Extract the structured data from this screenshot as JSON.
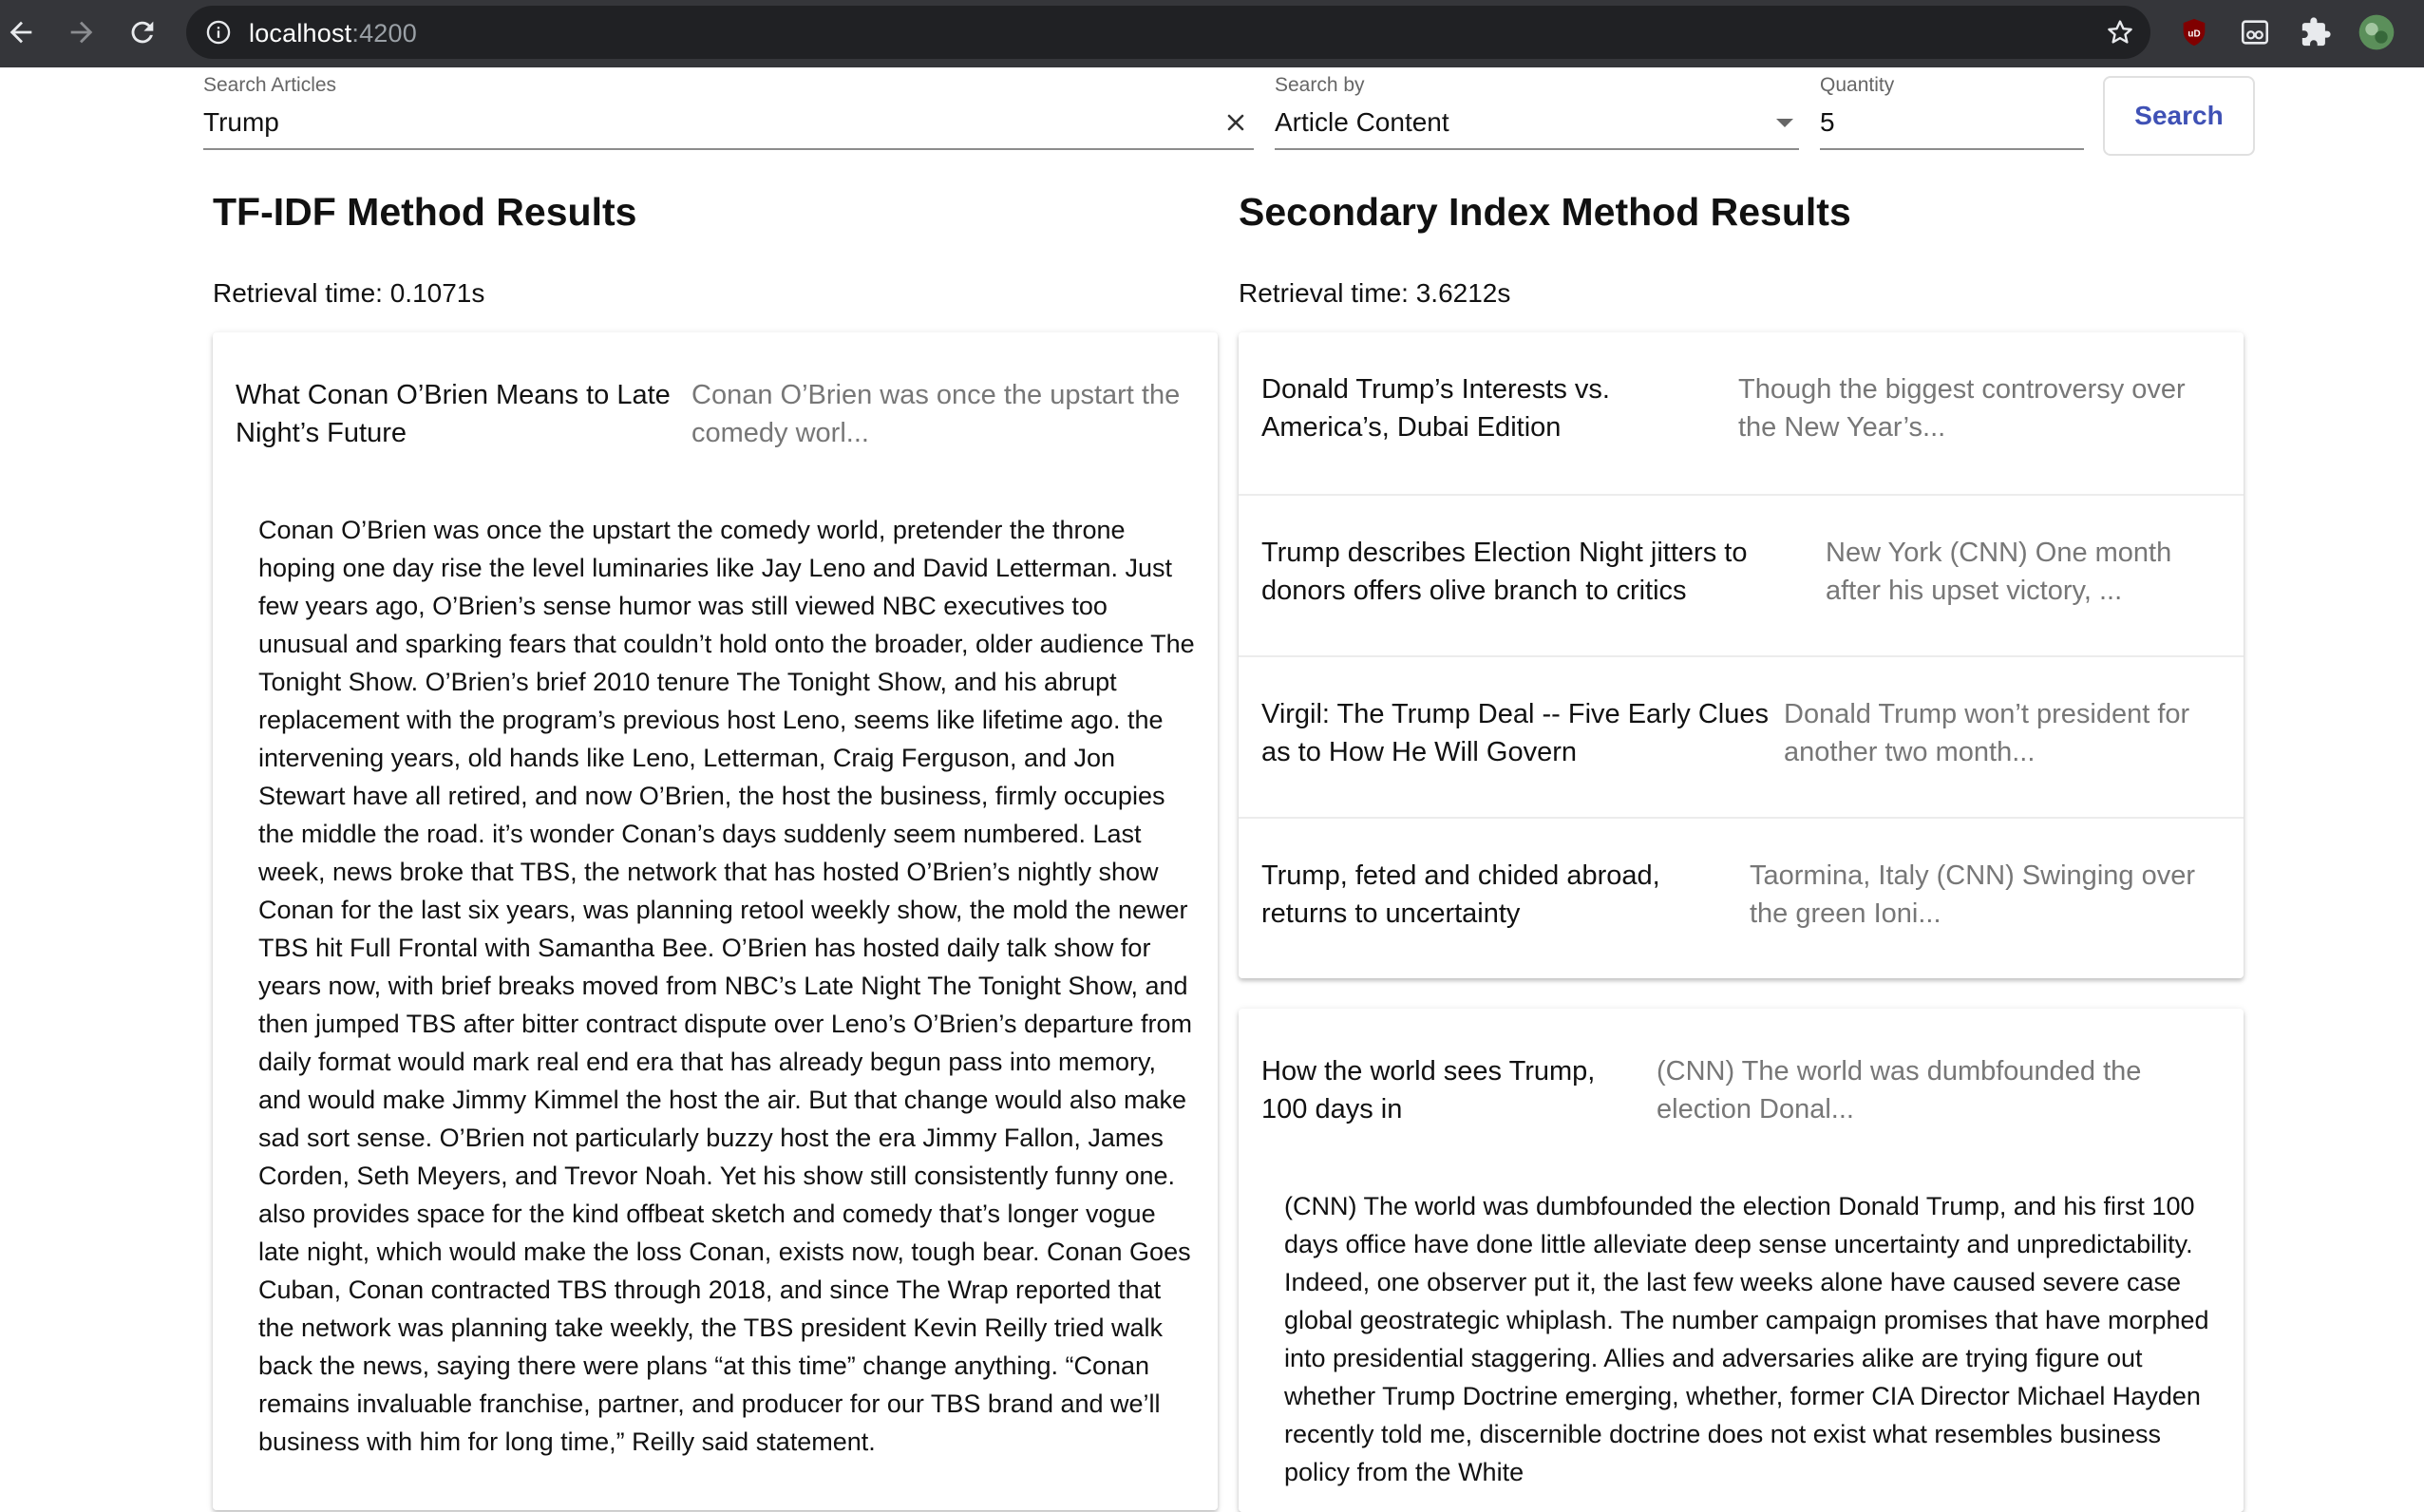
{
  "browser": {
    "url_host": "localhost",
    "url_port": ":4200"
  },
  "search_form": {
    "query_label": "Search Articles",
    "query_value": "Trump",
    "search_by_label": "Search by",
    "search_by_value": "Article Content",
    "quantity_label": "Quantity",
    "quantity_value": "5",
    "search_button": "Search"
  },
  "tfidf": {
    "title": "TF-IDF Method Results",
    "retrieval": "Retrieval time: 0.1071s",
    "items": [
      {
        "title": "What Conan O’Brien Means to Late Night’s Future",
        "snippet": "Conan O’Brien was once the upstart the comedy worl...",
        "body": "Conan O’Brien was once the upstart the comedy world, pretender the throne hoping one day rise the level luminaries like Jay Leno and David Letterman. Just few years ago, O’Brien’s sense humor was still viewed NBC executives too unusual and sparking fears that couldn’t hold onto the broader, older audience The Tonight Show. O’Brien’s brief 2010 tenure The Tonight Show, and his abrupt replacement with the program’s previous host Leno, seems like lifetime ago. the intervening years, old hands like Leno, Letterman, Craig Ferguson, and Jon Stewart have all retired, and now O’Brien, the host the business, firmly occupies the middle the road. it’s wonder Conan’s days suddenly seem numbered. Last week, news broke that TBS, the network that has hosted O’Brien’s nightly show Conan for the last six years, was planning retool weekly show, the mold the newer TBS hit Full Frontal with Samantha Bee. O’Brien has hosted daily talk show for years now, with brief breaks moved from NBC’s Late Night The Tonight Show, and then jumped TBS after bitter contract dispute over Leno’s O’Brien’s departure from daily format would mark real end era that has already begun pass into memory, and would make Jimmy Kimmel the host the air. But that change would also make sad sort sense. O’Brien not particularly buzzy host the era Jimmy Fallon, James Corden, Seth Meyers, and Trevor Noah. Yet his show still consistently funny one. also provides space for the kind offbeat sketch and comedy that’s longer vogue late night, which would make the loss Conan, exists now, tough bear. Conan Goes Cuban, Conan contracted TBS through 2018, and since The Wrap reported that the network was planning take weekly, the TBS president Kevin Reilly tried walk back the news, saying there were plans “at this time” change anything. “Conan remains invaluable franchise, partner, and producer for our TBS brand and we’ll business with him for long time,” Reilly said statement."
      }
    ]
  },
  "secondary": {
    "title": "Secondary Index Method Results",
    "retrieval": "Retrieval time: 3.6212s",
    "items": [
      {
        "title": "Donald Trump’s Interests vs. America’s, Dubai Edition",
        "snippet": "Though the biggest controversy over the New Year’s..."
      },
      {
        "title": "Trump describes Election Night jitters to donors offers olive branch to critics",
        "snippet": "New York (CNN) One month after his upset victory, ..."
      },
      {
        "title": "Virgil: The Trump Deal -- Five Early Clues as to How He Will Govern",
        "snippet": "Donald Trump won’t president for another two month..."
      },
      {
        "title": "Trump, feted and chided abroad, returns to uncertainty",
        "snippet": "Taormina, Italy (CNN) Swinging over the green Ioni..."
      },
      {
        "title": "How the world sees Trump, 100 days in",
        "snippet": "(CNN) The world was dumbfounded the election Donal...",
        "body": "(CNN) The world was dumbfounded the election Donald Trump, and his first 100 days office have done little alleviate deep sense uncertainty and unpredictability. Indeed, one observer put it, the last few weeks alone have caused severe case global geostrategic whiplash. The number campaign promises that have morphed into presidential staggering. Allies and adversaries alike are trying figure out whether Trump Doctrine emerging, whether, former CIA Director Michael Hayden recently told me, discernible doctrine does not exist what resembles business policy from the White"
      }
    ]
  }
}
